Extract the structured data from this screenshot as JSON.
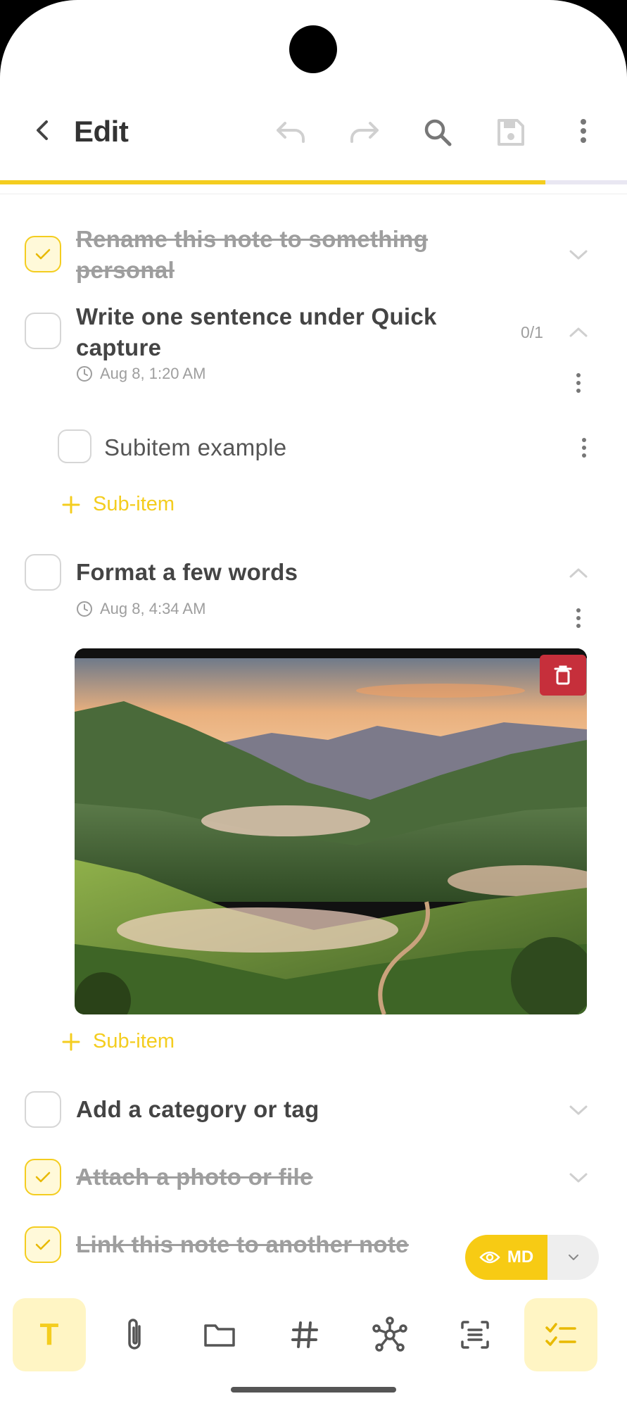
{
  "header": {
    "title": "Edit",
    "progress": 0.87
  },
  "tasks": [
    {
      "text": "Rename this note to something personal",
      "checked": true
    },
    {
      "text": "Write one sentence under Quick capture",
      "checked": false,
      "count": "0/1",
      "timestamp": "Aug 8, 1:20 AM",
      "subitems": [
        {
          "text": "Subitem example"
        }
      ],
      "add_subitem": "Sub-item"
    },
    {
      "text": "Format a few words",
      "checked": false,
      "timestamp": "Aug 8, 4:34 AM",
      "add_subitem": "Sub-item"
    },
    {
      "text": "Add a category or tag",
      "checked": false
    },
    {
      "text": "Attach a photo or file",
      "checked": true
    },
    {
      "text": "Link this note to another note",
      "checked": true
    }
  ],
  "md_toggle": {
    "label": "MD"
  },
  "toolbar": {
    "items": [
      "text-format-icon",
      "paperclip-icon",
      "folder-icon",
      "hashtag-icon",
      "graph-link-icon",
      "text-scan-icon",
      "checklist-icon"
    ]
  },
  "colors": {
    "accent": "#f4cd1f",
    "delete": "#c62f3b"
  }
}
